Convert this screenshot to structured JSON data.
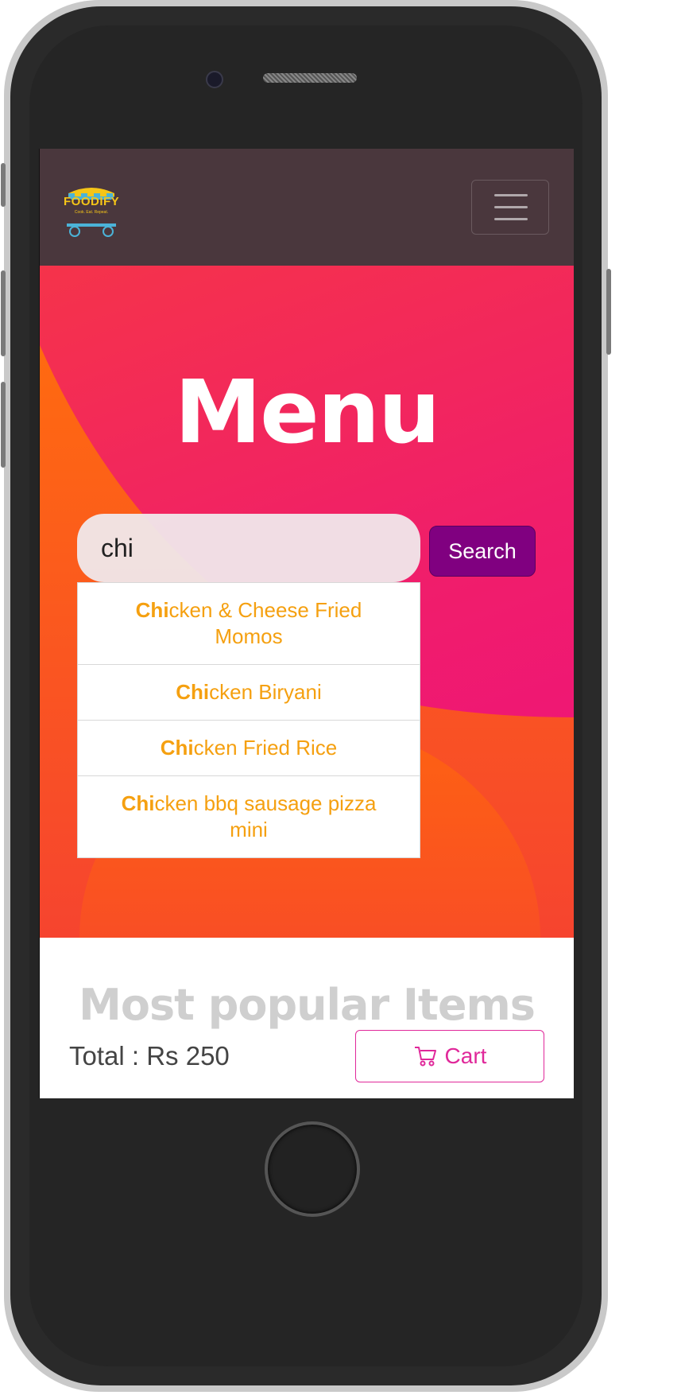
{
  "brand": {
    "name": "FOODIFY",
    "tagline": "Cook. Eat. Repeat."
  },
  "hero": {
    "title": "Menu"
  },
  "search": {
    "value": "chi",
    "button_label": "Search"
  },
  "suggestions": [
    {
      "match": "Chi",
      "rest": "cken & Cheese Fried Momos"
    },
    {
      "match": "Chi",
      "rest": "cken Biryani"
    },
    {
      "match": "Chi",
      "rest": "cken Fried Rice"
    },
    {
      "match": "Chi",
      "rest": "cken bbq sausage pizza mini"
    }
  ],
  "section": {
    "title": "Most popular Items"
  },
  "footer": {
    "total": "Total : Rs 250",
    "cart_label": "Cart"
  },
  "colors": {
    "navbar": "#4a373d",
    "accent": "#800080",
    "suggestion": "#f5a010",
    "cart": "#e0289a"
  }
}
